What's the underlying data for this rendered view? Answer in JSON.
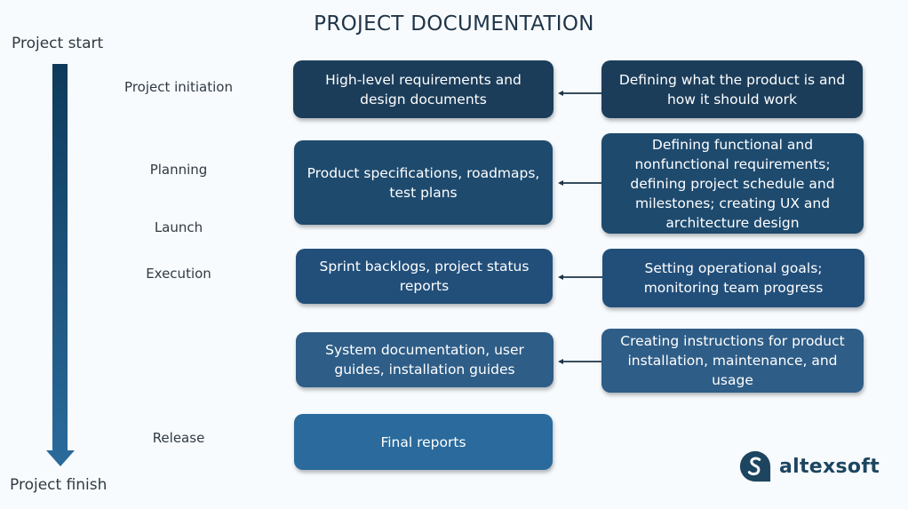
{
  "title": "PROJECT DOCUMENTATION",
  "timeline": {
    "start_label": "Project start",
    "finish_label": "Project finish",
    "gradient_colors": [
      "#0e3a5a",
      "#2a6b9c"
    ]
  },
  "phases": [
    {
      "label": "Project initiation"
    },
    {
      "label": "Planning"
    },
    {
      "label": "Launch"
    },
    {
      "label": "Execution"
    },
    {
      "label": "Release"
    }
  ],
  "rows": [
    {
      "document": "High-level requirements and design documents",
      "activity": "Defining what the product is and how it should work",
      "color": "#1b3d5a"
    },
    {
      "document": "Product specifications, roadmaps, test plans",
      "activity": "Defining functional and nonfunctional requirements; defining project schedule and milestones; creating UX and architecture design",
      "color": "#1e4a6e"
    },
    {
      "document": "Sprint backlogs, project status reports",
      "activity": "Setting operational goals; monitoring team progress",
      "color": "#224f7a"
    },
    {
      "document": "System documentation, user guides, installation guides",
      "activity": "Creating instructions for product installation, maintenance, and usage",
      "color": "#2e5d87"
    },
    {
      "document": "Final reports",
      "activity": null,
      "color": "#2a6a9c"
    }
  ],
  "logo": {
    "text": "altexsoft",
    "color": "#1d4560"
  }
}
